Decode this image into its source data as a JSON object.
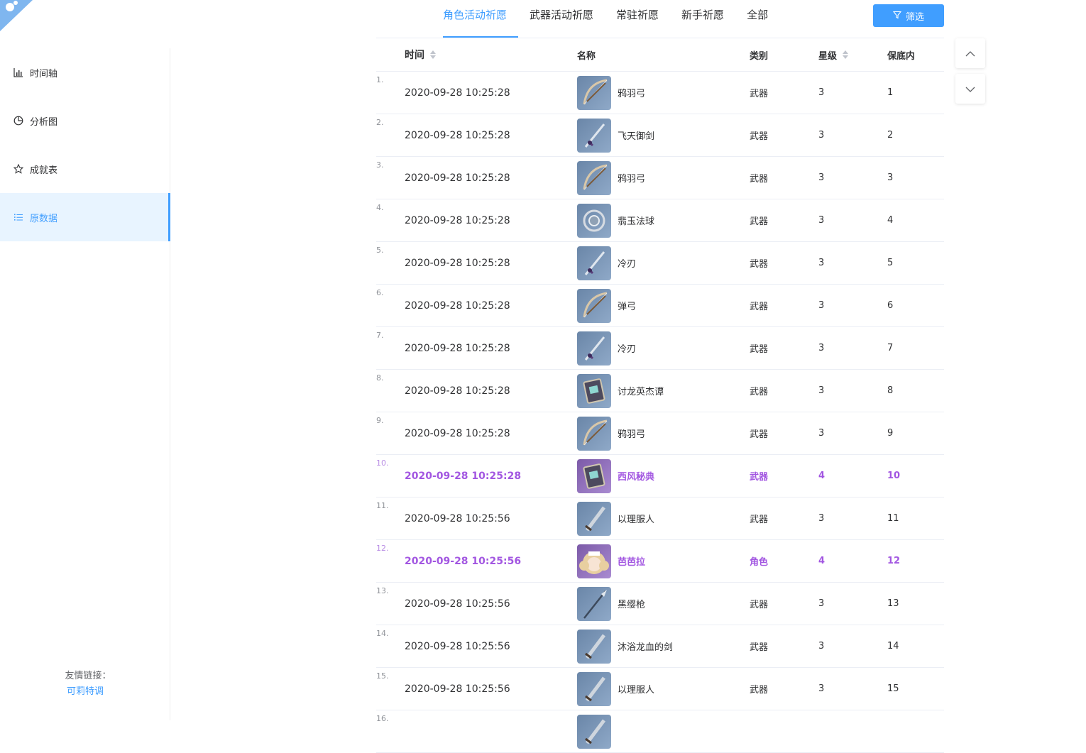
{
  "sidebar": {
    "items": [
      {
        "label": "时间轴",
        "icon": "bar-chart-icon"
      },
      {
        "label": "分析图",
        "icon": "pie-chart-icon"
      },
      {
        "label": "成就表",
        "icon": "star-icon"
      },
      {
        "label": "原数据",
        "icon": "list-icon",
        "active": true
      }
    ],
    "friend_label": "友情链接：",
    "friend_link": "可莉特调"
  },
  "tabs": [
    {
      "label": "角色活动祈愿",
      "active": true
    },
    {
      "label": "武器活动祈愿"
    },
    {
      "label": "常驻祈愿"
    },
    {
      "label": "新手祈愿"
    },
    {
      "label": "全部"
    }
  ],
  "filter_button": "筛选",
  "table": {
    "headers": {
      "time": "时间",
      "name": "名称",
      "category": "类别",
      "star": "星级",
      "pity": "保底内"
    },
    "rows": [
      {
        "idx": "1.",
        "time": "2020-09-28 10:25:28",
        "name": "鸦羽弓",
        "category": "武器",
        "star": "3",
        "pity": "1",
        "icon": "bow-icon"
      },
      {
        "idx": "2.",
        "time": "2020-09-28 10:25:28",
        "name": "飞天御剑",
        "category": "武器",
        "star": "3",
        "pity": "2",
        "icon": "sword-icon"
      },
      {
        "idx": "3.",
        "time": "2020-09-28 10:25:28",
        "name": "鸦羽弓",
        "category": "武器",
        "star": "3",
        "pity": "3",
        "icon": "bow-icon"
      },
      {
        "idx": "4.",
        "time": "2020-09-28 10:25:28",
        "name": "翡玉法球",
        "category": "武器",
        "star": "3",
        "pity": "4",
        "icon": "orb-icon"
      },
      {
        "idx": "5.",
        "time": "2020-09-28 10:25:28",
        "name": "冷刃",
        "category": "武器",
        "star": "3",
        "pity": "5",
        "icon": "sword-icon"
      },
      {
        "idx": "6.",
        "time": "2020-09-28 10:25:28",
        "name": "弹弓",
        "category": "武器",
        "star": "3",
        "pity": "6",
        "icon": "bow-icon"
      },
      {
        "idx": "7.",
        "time": "2020-09-28 10:25:28",
        "name": "冷刃",
        "category": "武器",
        "star": "3",
        "pity": "7",
        "icon": "sword-icon"
      },
      {
        "idx": "8.",
        "time": "2020-09-28 10:25:28",
        "name": "讨龙英杰谭",
        "category": "武器",
        "star": "3",
        "pity": "8",
        "icon": "book-icon"
      },
      {
        "idx": "9.",
        "time": "2020-09-28 10:25:28",
        "name": "鸦羽弓",
        "category": "武器",
        "star": "3",
        "pity": "9",
        "icon": "bow-icon"
      },
      {
        "idx": "10.",
        "time": "2020-09-28 10:25:28",
        "name": "西风秘典",
        "category": "武器",
        "star": "4",
        "pity": "10",
        "icon": "book-icon",
        "highlight": true
      },
      {
        "idx": "11.",
        "time": "2020-09-28 10:25:56",
        "name": "以理服人",
        "category": "武器",
        "star": "3",
        "pity": "11",
        "icon": "claymore-icon"
      },
      {
        "idx": "12.",
        "time": "2020-09-28 10:25:56",
        "name": "芭芭拉",
        "category": "角色",
        "star": "4",
        "pity": "12",
        "icon": "character-portrait-icon",
        "highlight": true
      },
      {
        "idx": "13.",
        "time": "2020-09-28 10:25:56",
        "name": "黑缨枪",
        "category": "武器",
        "star": "3",
        "pity": "13",
        "icon": "polearm-icon"
      },
      {
        "idx": "14.",
        "time": "2020-09-28 10:25:56",
        "name": "沐浴龙血的剑",
        "category": "武器",
        "star": "3",
        "pity": "14",
        "icon": "claymore-icon"
      },
      {
        "idx": "15.",
        "time": "2020-09-28 10:25:56",
        "name": "以理服人",
        "category": "武器",
        "star": "3",
        "pity": "15",
        "icon": "claymore-icon"
      },
      {
        "idx": "16.",
        "time": "",
        "name": "",
        "category": "",
        "star": "",
        "pity": "",
        "icon": "claymore-icon"
      }
    ]
  },
  "colors": {
    "accent": "#409eff",
    "four_star": "#a256e1",
    "active_bg": "#e8f4ff"
  }
}
